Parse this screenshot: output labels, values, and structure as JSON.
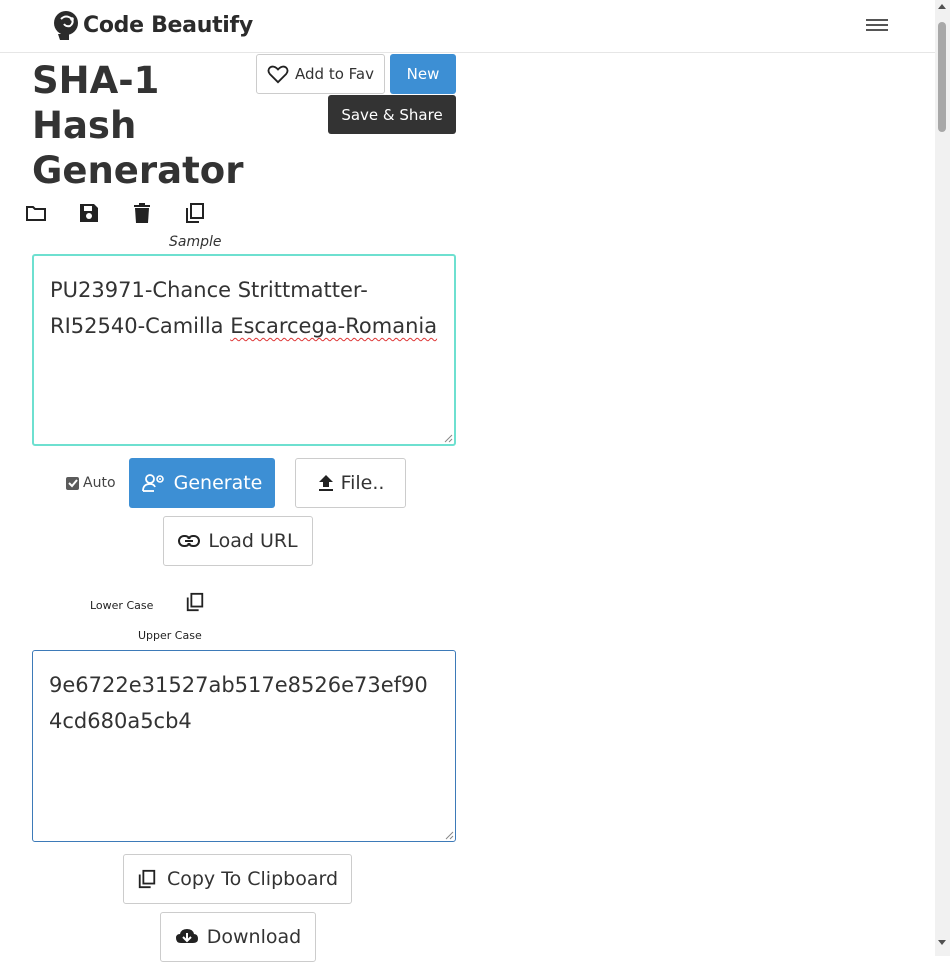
{
  "header": {
    "brand": "Code Beautify",
    "logo_icon": "brain-head-logo",
    "menu_icon": "hamburger-menu-icon"
  },
  "page": {
    "title": "SHA-1 Hash Generator",
    "add_fav_label": "Add to Fav",
    "new_label": "New",
    "save_share_label": "Save & Share"
  },
  "toolbar": {
    "icons": [
      "folder-open-icon",
      "save-icon",
      "trash-icon",
      "copy-icon"
    ],
    "sample_label": "Sample"
  },
  "input": {
    "value_part1": "PU23971-Chance Strittmatter-RI52540-Camilla ",
    "value_misspelled": "Escarcega-Romania"
  },
  "controls": {
    "auto_label": "Auto",
    "auto_checked": true,
    "generate_label": "Generate",
    "file_label": "File..",
    "load_url_label": "Load URL"
  },
  "case_options": {
    "lower_label": "Lower Case",
    "upper_label": "Upper Case"
  },
  "output": {
    "value": "9e6722e31527ab517e8526e73ef904cd680a5cb4"
  },
  "actions": {
    "copy_label": "Copy To Clipboard",
    "download_label": "Download"
  },
  "colors": {
    "primary": "#3d8fd4",
    "dark": "#333333",
    "input_border": "#6ee0d0",
    "output_border": "#3d7ab8"
  }
}
